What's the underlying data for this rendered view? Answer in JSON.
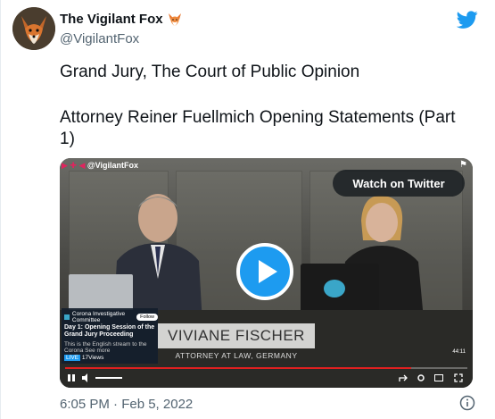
{
  "author": {
    "display_name": "The Vigilant Fox",
    "handle": "@VigilantFox"
  },
  "tweet": {
    "line1": "Grand Jury, The Court of Public Opinion",
    "line2": "Attorney Reiner Fuellmich Opening Statements (Part",
    "line3": "1)",
    "timestamp": "6:05 PM · Feb 5, 2022"
  },
  "media": {
    "channel_tag": "@VigilantFox",
    "watch_label": "Watch on Twitter",
    "lower_third_name": "VIVIANE FISCHER",
    "lower_third_title": "ATTORNEY AT LAW, GERMANY",
    "overlay": {
      "channel": "Corona Investigative Committee",
      "follow": "Follow",
      "title": "Day 1: Opening Session of the Grand Jury Proceeding",
      "subtitle": "This is the English stream to the Corona",
      "see_more": "See more",
      "live_badge": "LIVE",
      "viewers": "17Views",
      "time": "44:11"
    },
    "progress": 0.86
  },
  "colors": {
    "accent": "#1d9bf0",
    "text_primary": "#0f1419",
    "text_secondary": "#536471"
  }
}
